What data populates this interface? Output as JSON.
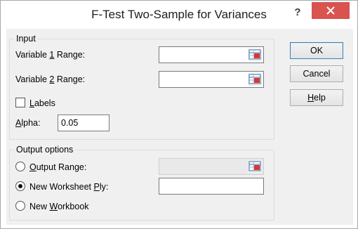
{
  "window": {
    "title": "F-Test Two-Sample for Variances",
    "help_glyph": "?",
    "close_glyph": "×"
  },
  "input": {
    "group_label": "Input",
    "var1": {
      "pre": "Variable ",
      "key": "1",
      "post": " Range:",
      "value": ""
    },
    "var2": {
      "pre": "Variable ",
      "key": "2",
      "post": " Range:",
      "value": ""
    },
    "labels": {
      "key": "L",
      "rest": "abels",
      "checked": false
    },
    "alpha": {
      "key": "A",
      "rest": "lpha:",
      "value": "0.05"
    }
  },
  "output": {
    "group_label": "Output options",
    "output_range": {
      "key": "O",
      "rest": "utput Range:",
      "selected": false,
      "value": ""
    },
    "new_ply": {
      "pre": "New Worksheet ",
      "key": "P",
      "rest": "ly:",
      "selected": true,
      "value": ""
    },
    "new_workbook": {
      "pre": "New ",
      "key": "W",
      "rest": "orkbook",
      "selected": false
    }
  },
  "buttons": {
    "ok": "OK",
    "cancel": "Cancel",
    "help": {
      "key": "H",
      "rest": "elp"
    }
  },
  "colors": {
    "close_button": "#d9534f",
    "default_button_border": "#3c7fb1"
  }
}
